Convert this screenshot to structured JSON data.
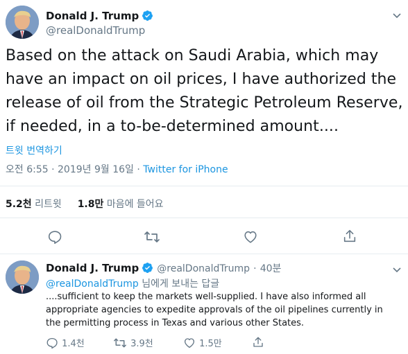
{
  "main_tweet": {
    "author_name": "Donald J. Trump",
    "author_handle": "@realDonaldTrump",
    "text": "Based on the attack on Saudi Arabia, which may have an impact on oil prices, I have authorized the release of oil from the Strategic Petroleum Reserve, if needed, in a to-be-determined amount....",
    "translate_label": "트윗 번역하기",
    "time": "오전 6:55",
    "date": "2019년 9월 16일",
    "separator": "·",
    "client": "Twitter for iPhone",
    "retweets_count": "5.2천",
    "retweets_label": "리트윗",
    "likes_count": "1.8만",
    "likes_label": "마음에 들어요"
  },
  "reply": {
    "author_name": "Donald J. Trump",
    "author_handle": "@realDonaldTrump",
    "separator": "·",
    "time_ago": "40분",
    "replying_to_handle": "@realDonaldTrump",
    "replying_to_suffix": "님에게 보내는 답글",
    "text": "....sufficient to keep the markets well-supplied. I have also informed all appropriate agencies to expedite approvals of the oil pipelines currently in the permitting process in Texas and various other States.",
    "reply_count": "1.4천",
    "retweet_count": "3.9천",
    "like_count": "1.5만"
  },
  "colors": {
    "link": "#1b95e0",
    "secondary": "#657786",
    "divider": "#e6ecf0",
    "verified": "#1da1f2"
  }
}
